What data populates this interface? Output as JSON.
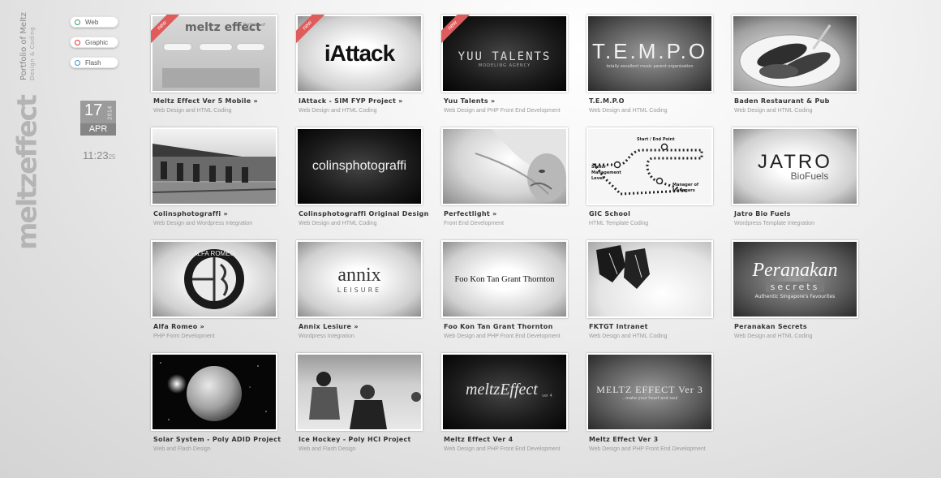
{
  "brand": {
    "logo": "meltzeffect",
    "subtitle": "Portfolio of Meltz",
    "tagline": "Design & Coding"
  },
  "filters": [
    {
      "label": "Web",
      "color": "#33aa33"
    },
    {
      "label": "Graphic",
      "color": "#dd3333"
    },
    {
      "label": "Flash",
      "color": "#3399cc"
    }
  ],
  "date": {
    "day": "17",
    "year": "2014",
    "month": "APR"
  },
  "clock": {
    "time": "11:23",
    "seconds": "25"
  },
  "projects": [
    {
      "title": "Meltz Effect Ver 5 Mobile »",
      "desc": "Web Design and HTML Coding",
      "new": "new",
      "thumb_text": "meltz effect",
      "thumb_sub": "Portfolio of Meltz",
      "thumb_icon": "website-screenshot-icon"
    },
    {
      "title": "IAttack - SIM FYP Project »",
      "desc": "Web Design and HTML Coding",
      "new": "new",
      "thumb_text": "iAttack",
      "thumb_icon": "iattack-logo-icon"
    },
    {
      "title": "Yuu Talents »",
      "desc": "Web Design and PHP Front End Development",
      "new": "new",
      "thumb_text": "YUU TALENTS",
      "thumb_sub": "MODELING AGENCY",
      "thumb_icon": "yuu-talents-logo-icon"
    },
    {
      "title": "T.E.M.P.O",
      "desc": "Web Design and HTML Coding",
      "thumb_text": "T.E.M.P.O",
      "thumb_sub": "totally excellent music parent organization",
      "thumb_icon": "tempo-logo-icon"
    },
    {
      "title": "Baden Restaurant & Pub",
      "desc": "Web Design and HTML Coding",
      "thumb_icon": "sausage-plate-photo-icon"
    },
    {
      "title": "Colinsphotograffi »",
      "desc": "Web Design and Wordpress Integration",
      "thumb_icon": "train-station-photo-icon"
    },
    {
      "title": "Colinsphotograffi Original Design",
      "desc": "Web Design and HTML Coding",
      "thumb_text": "colinsphotograffi",
      "thumb_icon": "colinsphotograffi-logo-icon"
    },
    {
      "title": "Perfectlight »",
      "desc": "Front End Development",
      "thumb_icon": "portrait-photo-icon"
    },
    {
      "title": "GIC School",
      "desc": "HTML Template Coding",
      "thumb_text": "Start / End Point",
      "thumb_sub": "Senior Management Level",
      "thumb_sub2": "Manager of Managers",
      "thumb_icon": "path-diagram-icon"
    },
    {
      "title": "Jatro Bio Fuels",
      "desc": "Wordpress Template Integration",
      "thumb_text": "JATRO",
      "thumb_sub": "BioFuels",
      "thumb_icon": "jatro-logo-icon"
    },
    {
      "title": "Alfa Romeo »",
      "desc": "PHP Form Development",
      "thumb_text": "ALFA ROMEO",
      "thumb_icon": "alfa-romeo-badge-icon"
    },
    {
      "title": "Annix Lesiure »",
      "desc": "Wordpress Integration",
      "thumb_text": "annix",
      "thumb_sub": "LEISURE",
      "thumb_icon": "annix-logo-icon"
    },
    {
      "title": "Foo Kon Tan Grant Thornton",
      "desc": "Web Design and PHP Front End Development",
      "thumb_text": "Foo Kon Tan Grant Thornton",
      "thumb_icon": "fktgt-logo-icon"
    },
    {
      "title": "FKTGT Intranet",
      "desc": "Web Design and HTML Coding",
      "thumb_icon": "shoes-photo-icon"
    },
    {
      "title": "Peranakan Secrets",
      "desc": "Web Design and HTML Coding",
      "thumb_text": "Peranakan",
      "thumb_sub": "secrets",
      "thumb_sub2": "Authentic Singapore's Favourites",
      "thumb_icon": "peranakan-logo-icon"
    },
    {
      "title": "Solar System - Poly ADID Project",
      "desc": "Web and Flash Design",
      "thumb_icon": "planet-icon"
    },
    {
      "title": "Ice Hockey - Poly HCI Project",
      "desc": "Web and Flash Design",
      "thumb_icon": "hockey-players-photo-icon"
    },
    {
      "title": "Meltz Effect Ver 4",
      "desc": "Web Design and PHP Front End Development",
      "thumb_text": "meltzEffect",
      "thumb_sub": "ver 4",
      "thumb_icon": "meltz-effect-v4-logo-icon"
    },
    {
      "title": "Meltz Effect Ver 3",
      "desc": "Web Design and PHP Front End Development",
      "thumb_text": "MELTZ EFFECT Ver 3",
      "thumb_sub": "...make your heart and soul",
      "thumb_icon": "meltz-effect-v3-logo-icon"
    }
  ]
}
